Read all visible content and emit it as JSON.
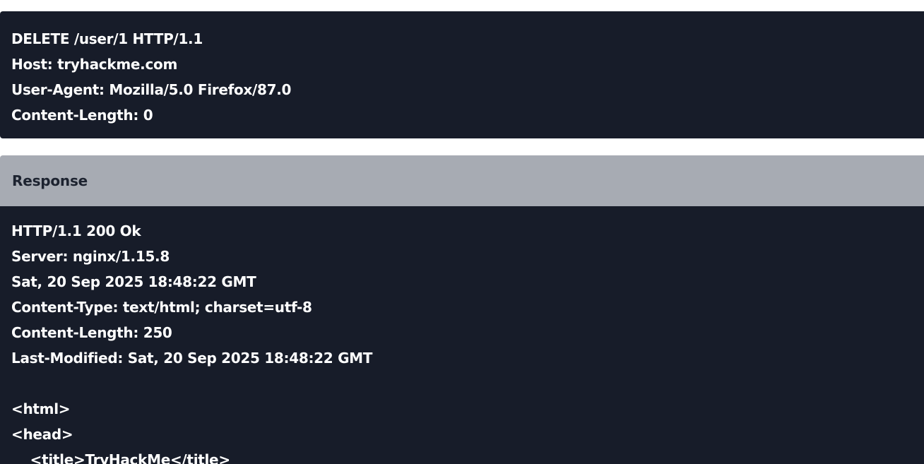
{
  "request": {
    "lines": [
      "DELETE /user/1 HTTP/1.1",
      "Host: tryhackme.com",
      "User-Agent: Mozilla/5.0 Firefox/87.0",
      "Content-Length: 0"
    ]
  },
  "response": {
    "header_label": "Response",
    "lines": [
      "HTTP/1.1 200 Ok",
      "Server: nginx/1.15.8",
      "Sat, 20 Sep 2025 18:48:22 GMT",
      "Content-Type: text/html; charset=utf-8",
      "Content-Length: 250",
      "Last-Modified: Sat, 20 Sep 2025 18:48:22 GMT",
      "",
      "<html>",
      "<head>",
      "    <title>TryHackMe</title>"
    ]
  },
  "colors": {
    "code_background": "#171c29",
    "header_background": "#a7abb3",
    "code_text": "#ffffff"
  }
}
